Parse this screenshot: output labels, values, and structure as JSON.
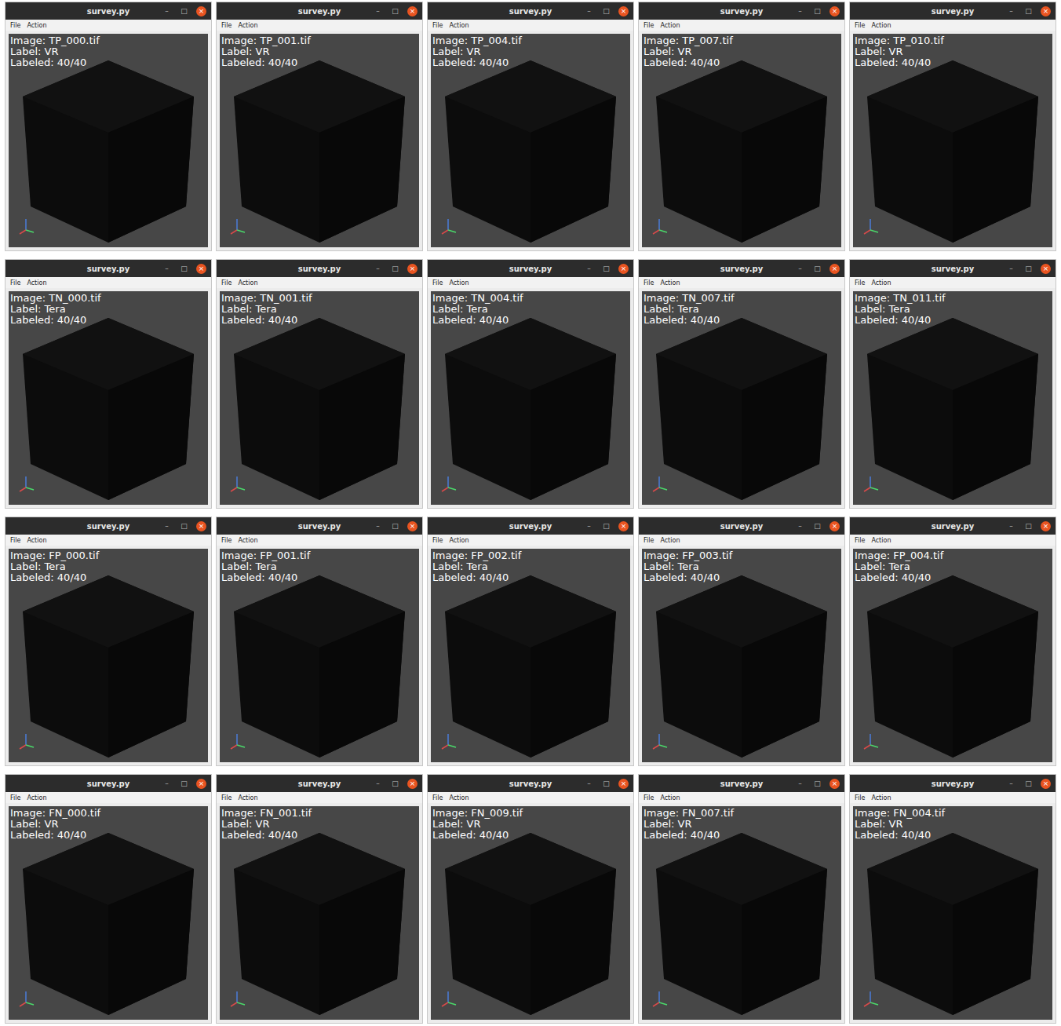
{
  "window_title": "survey.py",
  "controls": [
    "–",
    "□",
    "×"
  ],
  "menu": [
    "File",
    "Action"
  ],
  "windows": [
    {
      "image": "Image: TP_000.tif",
      "label": "Label: VR",
      "labeled": "Labeled: 40/40"
    },
    {
      "image": "Image: TP_001.tif",
      "label": "Label: VR",
      "labeled": "Labeled: 40/40"
    },
    {
      "image": "Image: TP_004.tif",
      "label": "Label: VR",
      "labeled": "Labeled: 40/40"
    },
    {
      "image": "Image: TP_007.tif",
      "label": "Label: VR",
      "labeled": "Labeled: 40/40"
    },
    {
      "image": "Image: TP_010.tif",
      "label": "Label: VR",
      "labeled": "Labeled: 40/40"
    },
    {
      "image": "Image: TN_000.tif",
      "label": "Label: Tera",
      "labeled": "Labeled: 40/40"
    },
    {
      "image": "Image: TN_001.tif",
      "label": "Label: Tera",
      "labeled": "Labeled: 40/40"
    },
    {
      "image": "Image: TN_004.tif",
      "label": "Label: Tera",
      "labeled": "Labeled: 40/40"
    },
    {
      "image": "Image: TN_007.tif",
      "label": "Label: Tera",
      "labeled": "Labeled: 40/40"
    },
    {
      "image": "Image: TN_011.tif",
      "label": "Label: Tera",
      "labeled": "Labeled: 40/40"
    },
    {
      "image": "Image: FP_000.tif",
      "label": "Label: Tera",
      "labeled": "Labeled: 40/40"
    },
    {
      "image": "Image: FP_001.tif",
      "label": "Label: Tera",
      "labeled": "Labeled: 40/40"
    },
    {
      "image": "Image: FP_002.tif",
      "label": "Label: Tera",
      "labeled": "Labeled: 40/40"
    },
    {
      "image": "Image: FP_003.tif",
      "label": "Label: Tera",
      "labeled": "Labeled: 40/40"
    },
    {
      "image": "Image: FP_004.tif",
      "label": "Label: Tera",
      "labeled": "Labeled: 40/40"
    },
    {
      "image": "Image: FN_000.tif",
      "label": "Label: VR",
      "labeled": "Labeled: 40/40"
    },
    {
      "image": "Image: FN_001.tif",
      "label": "Label: VR",
      "labeled": "Labeled: 40/40"
    },
    {
      "image": "Image: FN_009.tif",
      "label": "Label: VR",
      "labeled": "Labeled: 40/40"
    },
    {
      "image": "Image: FN_007.tif",
      "label": "Label: VR",
      "labeled": "Labeled: 40/40"
    },
    {
      "image": "Image: FN_004.tif",
      "label": "Label: VR",
      "labeled": "Labeled: 40/40"
    }
  ]
}
